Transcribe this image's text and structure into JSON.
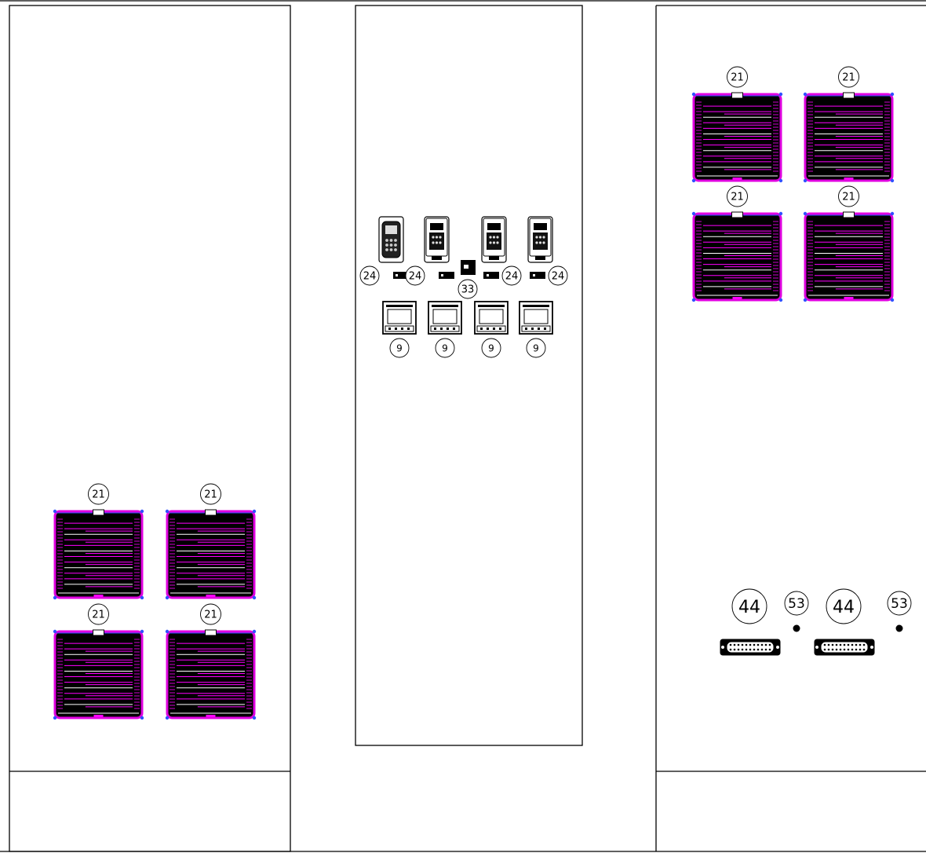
{
  "drawing": {
    "colors": {
      "line": "#000000",
      "grille_frame": "#e000e0",
      "grille_corner": "#3050ff",
      "grille_fill": "#000000",
      "grille_slat": "#ff00ff",
      "background": "#ffffff"
    },
    "callouts": {
      "filter_fan": "21",
      "drive_keypad": "24",
      "small_module": "33",
      "meter": "9",
      "connector": "44",
      "indicator": "53"
    },
    "left_panel": {
      "grilles": [
        {
          "balloon": "21"
        },
        {
          "balloon": "21"
        },
        {
          "balloon": "21"
        },
        {
          "balloon": "21"
        }
      ]
    },
    "center_panel": {
      "keypads": [
        {
          "balloon": "24"
        },
        {
          "balloon": "24"
        },
        {
          "balloon": "24"
        },
        {
          "balloon": "24"
        }
      ],
      "module": {
        "balloon": "33"
      },
      "meters": [
        {
          "balloon": "9"
        },
        {
          "balloon": "9"
        },
        {
          "balloon": "9"
        },
        {
          "balloon": "9"
        }
      ]
    },
    "right_panel": {
      "grilles": [
        {
          "balloon": "21"
        },
        {
          "balloon": "21"
        },
        {
          "balloon": "21"
        },
        {
          "balloon": "21"
        }
      ],
      "connectors": [
        {
          "balloon": "44"
        },
        {
          "balloon": "44"
        }
      ],
      "indicators": [
        {
          "balloon": "53"
        },
        {
          "balloon": "53"
        }
      ]
    }
  }
}
